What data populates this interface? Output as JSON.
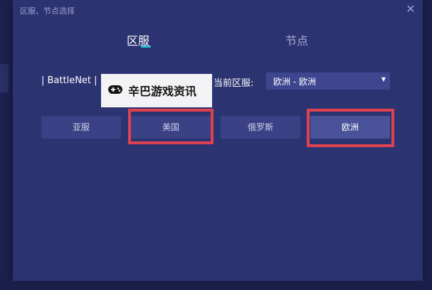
{
  "dialog": {
    "title": "区服、节点选择",
    "close_glyph": "✕"
  },
  "tabs": [
    {
      "label": "区服",
      "active": true
    },
    {
      "label": "节点",
      "active": false
    }
  ],
  "platform_label": "| BattleNet |",
  "current_region": {
    "label": "当前区服:",
    "value": "欧洲 - 欧洲",
    "chevron": "▼"
  },
  "servers": [
    {
      "label": "亚服"
    },
    {
      "label": "美国"
    },
    {
      "label": "俄罗斯"
    },
    {
      "label": "欧洲"
    }
  ],
  "watermark": {
    "text": "辛巴游戏资讯",
    "icon": "gamepad-icon"
  },
  "colors": {
    "accent": "#27c3d6",
    "highlight": "#e0414e",
    "dialog_bg": "#2c3371"
  }
}
